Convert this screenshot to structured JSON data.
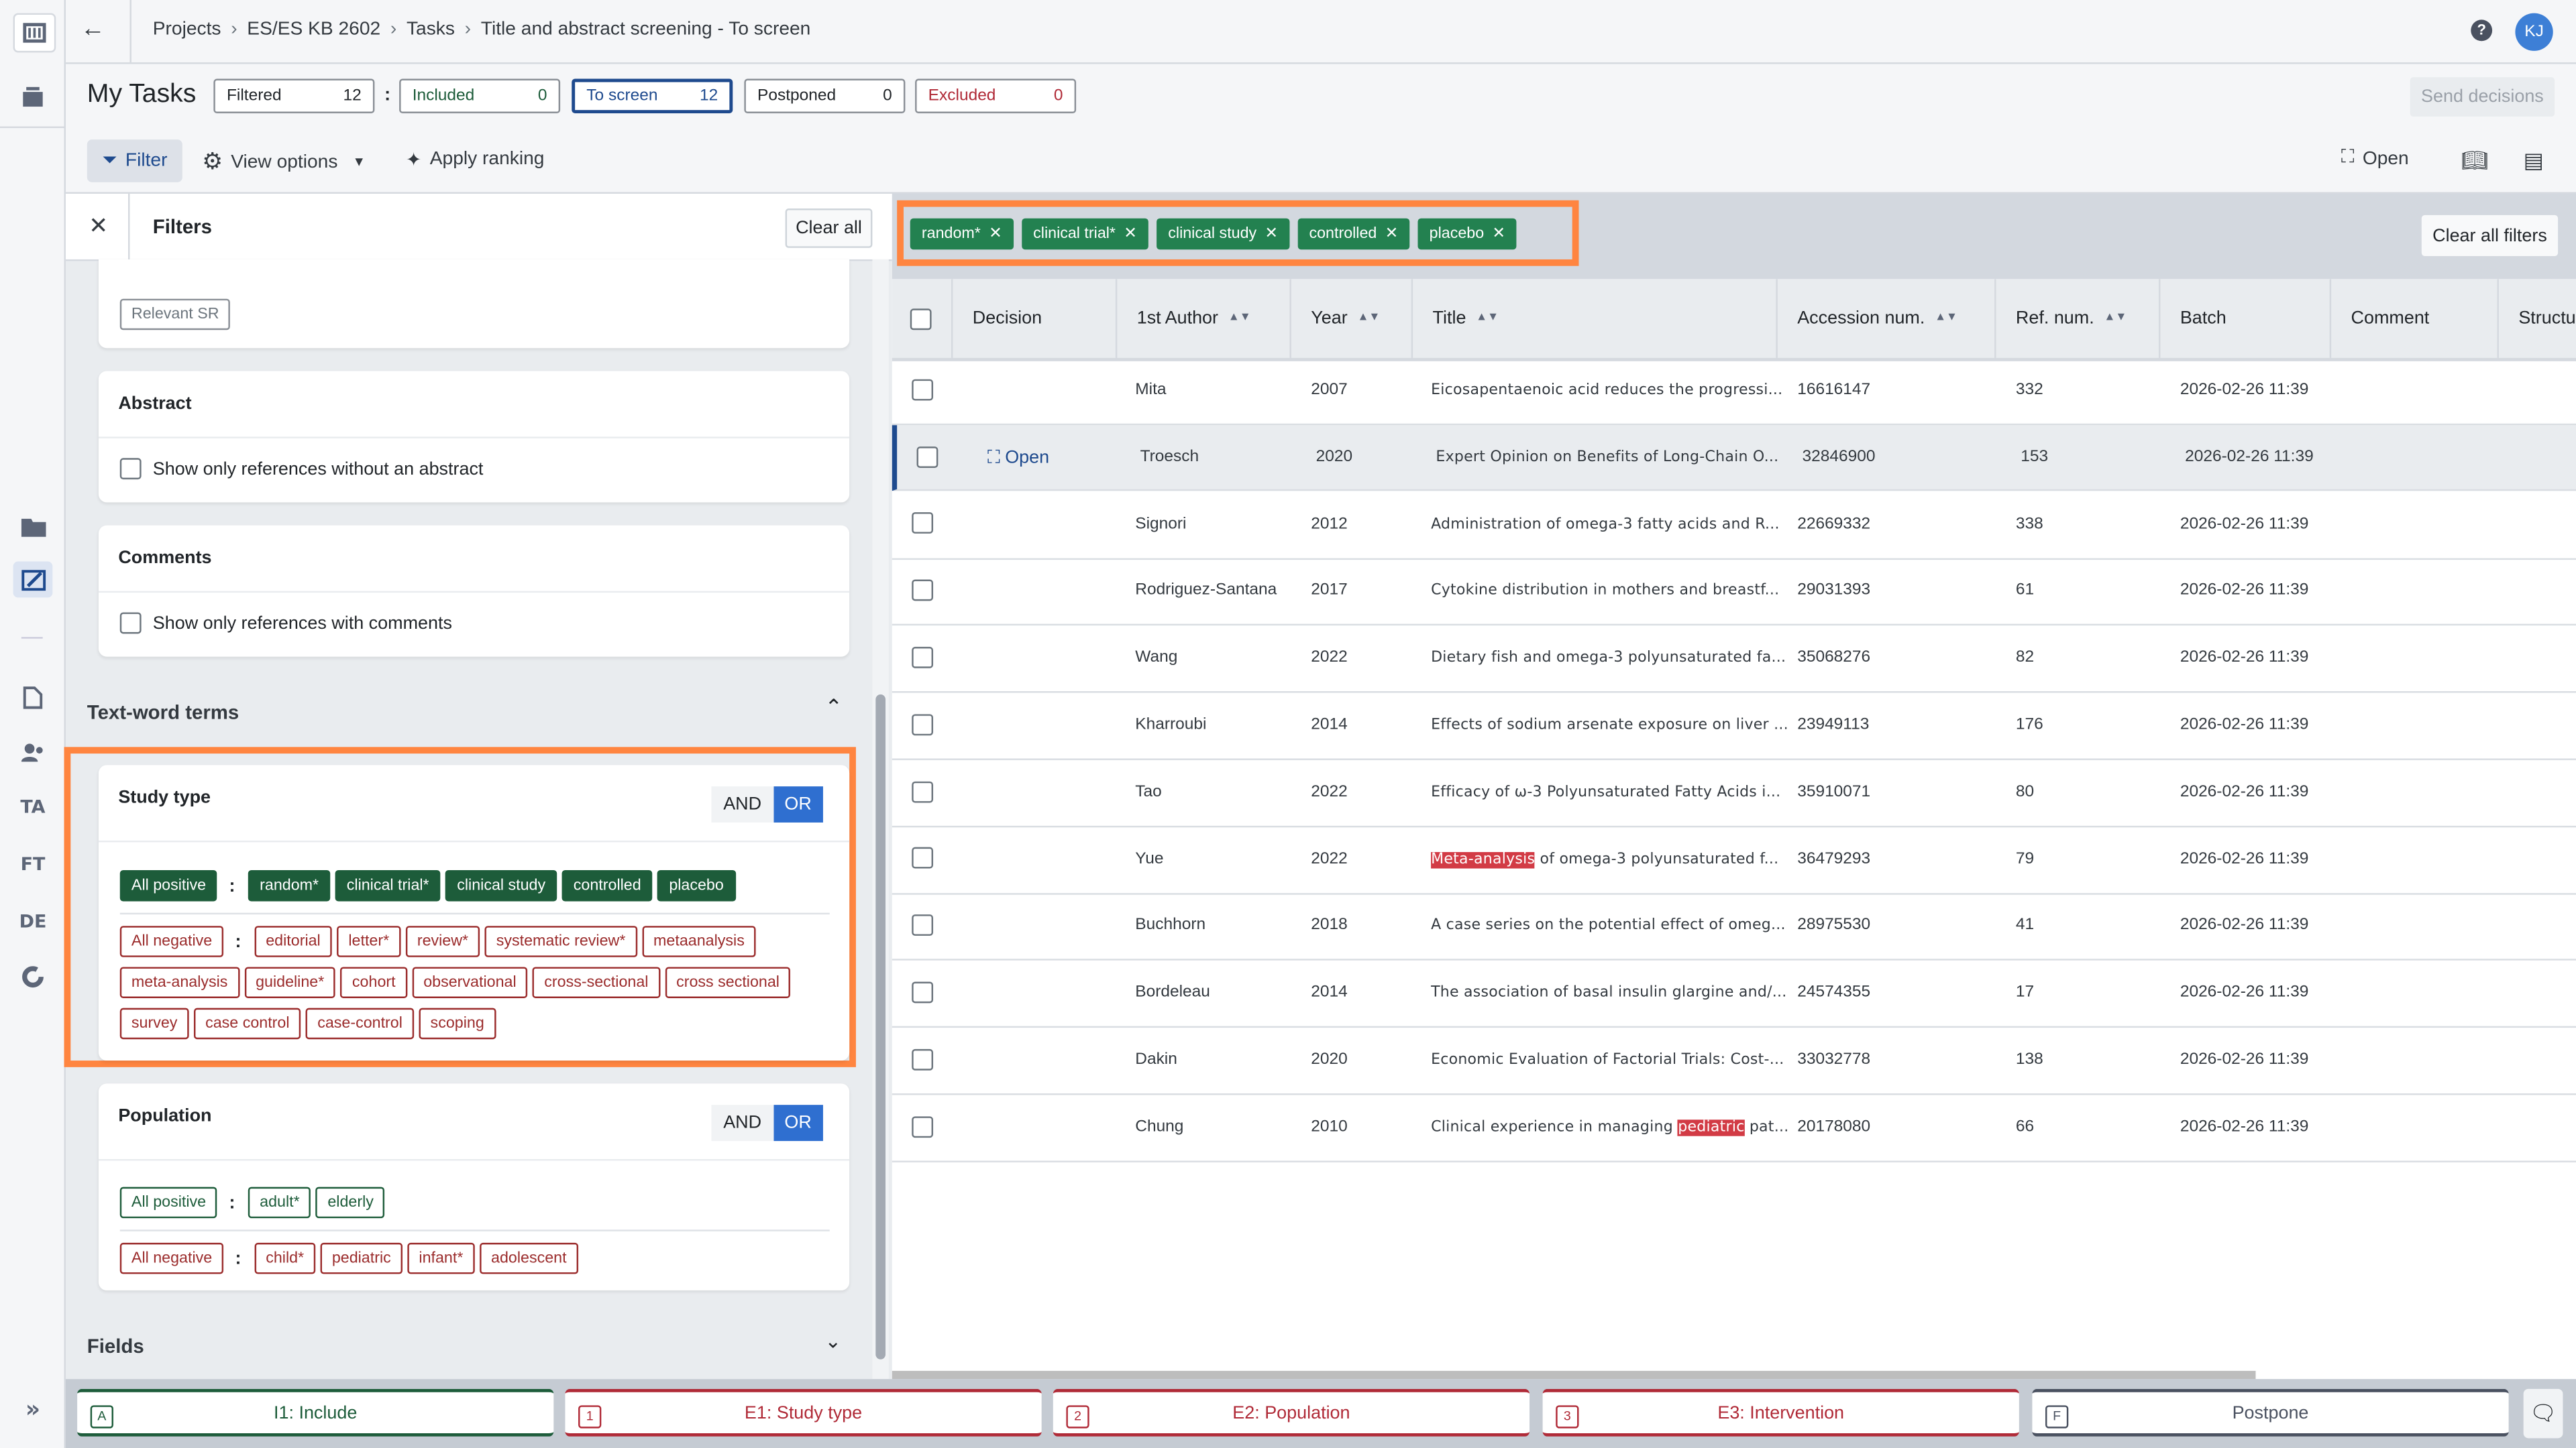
{
  "breadcrumb": [
    "Projects",
    "ES/ES KB 2602",
    "Tasks",
    "Title and abstract screening - To screen"
  ],
  "user_initials": "KJ",
  "page_title": "My Tasks",
  "stats": [
    {
      "label": "Filtered",
      "value": "12",
      "color": "#212529"
    },
    {
      "label": "Included",
      "value": "0",
      "color": "#1d5c3a"
    },
    {
      "label": "To screen",
      "value": "12",
      "color": "#1e4a8e"
    },
    {
      "label": "Postponed",
      "value": "0",
      "color": "#212529"
    },
    {
      "label": "Excluded",
      "value": "0",
      "color": "#b02a37"
    }
  ],
  "send_decisions": "Send decisions",
  "toolbar": {
    "filter": "Filter",
    "view_options": "View options",
    "apply_ranking": "Apply ranking",
    "open": "Open"
  },
  "rail": {
    "ta": "TA",
    "ft": "FT",
    "de": "DE"
  },
  "filters": {
    "title": "Filters",
    "clear_all": "Clear all",
    "relevant_sr": "Relevant SR",
    "abstract": {
      "title": "Abstract",
      "option": "Show only references without an abstract"
    },
    "comments": {
      "title": "Comments",
      "option": "Show only references with comments"
    },
    "text_word_terms": "Text-word terms",
    "study_type": {
      "title": "Study type",
      "and": "AND",
      "or": "OR",
      "all_positive": "All positive",
      "positive": [
        "random*",
        "clinical trial*",
        "clinical study",
        "controlled",
        "placebo"
      ],
      "all_negative": "All negative",
      "negative": [
        "editorial",
        "letter*",
        "review*",
        "systematic review*",
        "metaanalysis",
        "meta-analysis",
        "guideline*",
        "cohort",
        "observational",
        "cross-sectional",
        "cross sectional",
        "survey",
        "case control",
        "case-control",
        "scoping"
      ]
    },
    "population": {
      "title": "Population",
      "and": "AND",
      "or": "OR",
      "all_positive": "All positive",
      "positive": [
        "adult*",
        "elderly"
      ],
      "all_negative": "All negative",
      "negative": [
        "child*",
        "pediatric",
        "infant*",
        "adolescent"
      ]
    },
    "fields": "Fields"
  },
  "active_chips": [
    "random*",
    "clinical trial*",
    "clinical study",
    "controlled",
    "placebo"
  ],
  "clear_all_filters": "Clear all filters",
  "table": {
    "columns": [
      "Decision",
      "1st Author",
      "Year",
      "Title",
      "Accession num.",
      "Ref. num.",
      "Batch",
      "Comment",
      "Structu"
    ],
    "open_label": "Open",
    "rows": [
      {
        "author": "Mita",
        "year": "2007",
        "title": [
          {
            "t": "Eicosapentaenoic acid reduces the progressi..."
          }
        ],
        "acc": "16616147",
        "ref": "332",
        "batch": "2026-02-26 11:39"
      },
      {
        "author": "Troesch",
        "year": "2020",
        "title": [
          {
            "t": "Expert Opinion on Benefits of Long-Chain O..."
          }
        ],
        "acc": "32846900",
        "ref": "153",
        "batch": "2026-02-26 11:39",
        "selected": true
      },
      {
        "author": "Signori",
        "year": "2012",
        "title": [
          {
            "t": "Administration of omega-3 fatty acids and R..."
          }
        ],
        "acc": "22669332",
        "ref": "338",
        "batch": "2026-02-26 11:39"
      },
      {
        "author": "Rodriguez-Santana",
        "year": "2017",
        "title": [
          {
            "t": "Cytokine distribution in mothers and breastf..."
          }
        ],
        "acc": "29031393",
        "ref": "61",
        "batch": "2026-02-26 11:39"
      },
      {
        "author": "Wang",
        "year": "2022",
        "title": [
          {
            "t": "Dietary fish and omega-3 polyunsaturated fa..."
          }
        ],
        "acc": "35068276",
        "ref": "82",
        "batch": "2026-02-26 11:39"
      },
      {
        "author": "Kharroubi",
        "year": "2014",
        "title": [
          {
            "t": "Effects of sodium arsenate exposure on liver ..."
          }
        ],
        "acc": "23949113",
        "ref": "176",
        "batch": "2026-02-26 11:39"
      },
      {
        "author": "Tao",
        "year": "2022",
        "title": [
          {
            "t": "Efficacy of ω-3 Polyunsaturated Fatty Acids i..."
          }
        ],
        "acc": "35910071",
        "ref": "80",
        "batch": "2026-02-26 11:39"
      },
      {
        "author": "Yue",
        "year": "2022",
        "title": [
          {
            "t": "Meta-analysis",
            "hl": true
          },
          {
            "t": " of omega-3 polyunsaturated f..."
          }
        ],
        "acc": "36479293",
        "ref": "79",
        "batch": "2026-02-26 11:39"
      },
      {
        "author": "Buchhorn",
        "year": "2018",
        "title": [
          {
            "t": "A case series on the potential effect of omeg..."
          }
        ],
        "acc": "28975530",
        "ref": "41",
        "batch": "2026-02-26 11:39"
      },
      {
        "author": "Bordeleau",
        "year": "2014",
        "title": [
          {
            "t": "The association of basal insulin glargine and/..."
          }
        ],
        "acc": "24574355",
        "ref": "17",
        "batch": "2026-02-26 11:39"
      },
      {
        "author": "Dakin",
        "year": "2020",
        "title": [
          {
            "t": "Economic Evaluation of Factorial Trials: Cost-..."
          }
        ],
        "acc": "33032778",
        "ref": "138",
        "batch": "2026-02-26 11:39"
      },
      {
        "author": "Chung",
        "year": "2010",
        "title": [
          {
            "t": "Clinical experience in managing "
          },
          {
            "t": "pediatric",
            "hl": true
          },
          {
            "t": " pat..."
          }
        ],
        "acc": "20178080",
        "ref": "66",
        "batch": "2026-02-26 11:39"
      }
    ]
  },
  "decisions": [
    {
      "key": "A",
      "label": "I1: Include",
      "color": "#1d5c3a"
    },
    {
      "key": "1",
      "label": "E1: Study type",
      "color": "#b02a37"
    },
    {
      "key": "2",
      "label": "E2: Population",
      "color": "#b02a37"
    },
    {
      "key": "3",
      "label": "E3: Intervention",
      "color": "#b02a37"
    },
    {
      "key": "F",
      "label": "Postpone",
      "color": "#4a5160"
    }
  ],
  "colors": {
    "accent": "#2f6fd0",
    "highlight": "#ff8540",
    "positive": "#1d5c3a",
    "negative": "#9b2c2c"
  }
}
